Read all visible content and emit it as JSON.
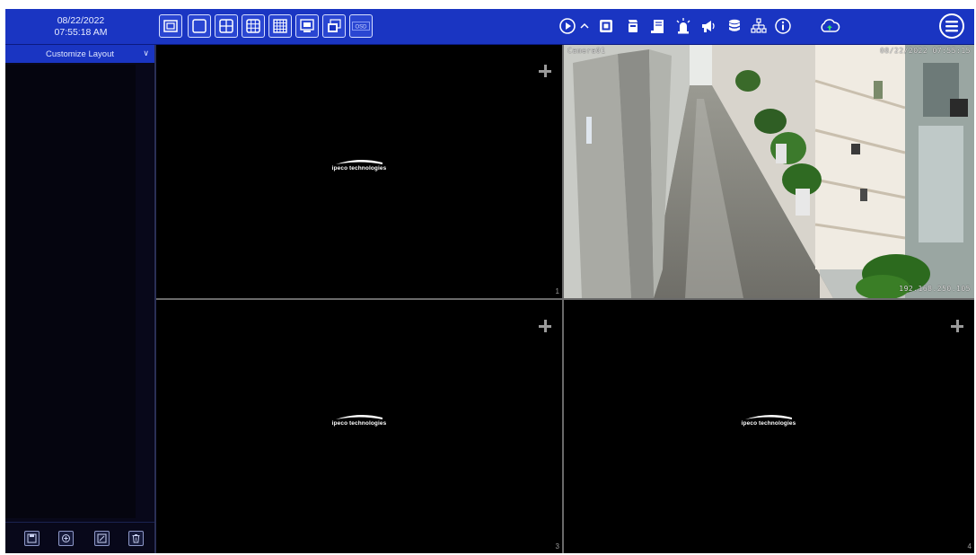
{
  "topbar": {
    "date": "08/22/2022",
    "time": "07:55:18 AM",
    "brand_color": "#1a35c2",
    "layout_buttons": [
      {
        "icon": "fullscreen-single-icon"
      },
      {
        "icon": "layout-1-icon"
      },
      {
        "icon": "layout-4-icon"
      },
      {
        "icon": "layout-9-icon"
      },
      {
        "icon": "layout-16-icon"
      },
      {
        "icon": "sequence-icon"
      },
      {
        "icon": "multi-window-icon"
      },
      {
        "icon": "osd-icon",
        "label": "OSD"
      }
    ],
    "right_buttons": [
      {
        "icon": "playback-icon"
      },
      {
        "icon": "collapse-chevron-icon"
      },
      {
        "icon": "channel-icon"
      },
      {
        "icon": "record-icon"
      },
      {
        "icon": "log-icon"
      },
      {
        "icon": "alarm-icon"
      },
      {
        "icon": "announce-icon"
      },
      {
        "icon": "disk-icon"
      },
      {
        "icon": "network-icon"
      },
      {
        "icon": "info-icon"
      },
      {
        "icon": "cloud-upgrade-icon"
      },
      {
        "icon": "main-menu-icon"
      }
    ]
  },
  "sidebar": {
    "header": "Customize Layout",
    "footer_buttons": [
      {
        "icon": "save-layout-icon"
      },
      {
        "icon": "add-layout-icon"
      },
      {
        "icon": "rename-layout-icon"
      },
      {
        "icon": "delete-layout-icon"
      }
    ]
  },
  "panes": [
    {
      "number": "1",
      "logo": "ipeco technologies",
      "has_feed": false
    },
    {
      "number": "",
      "has_feed": true,
      "camera_name": "Camera01",
      "timestamp": "08/22/2022 07:55:15",
      "ip_overlay": "192.168.250.105"
    },
    {
      "number": "3",
      "logo": "ipeco technologies",
      "has_feed": false
    },
    {
      "number": "4",
      "logo": "ipeco technologies",
      "has_feed": false
    }
  ]
}
